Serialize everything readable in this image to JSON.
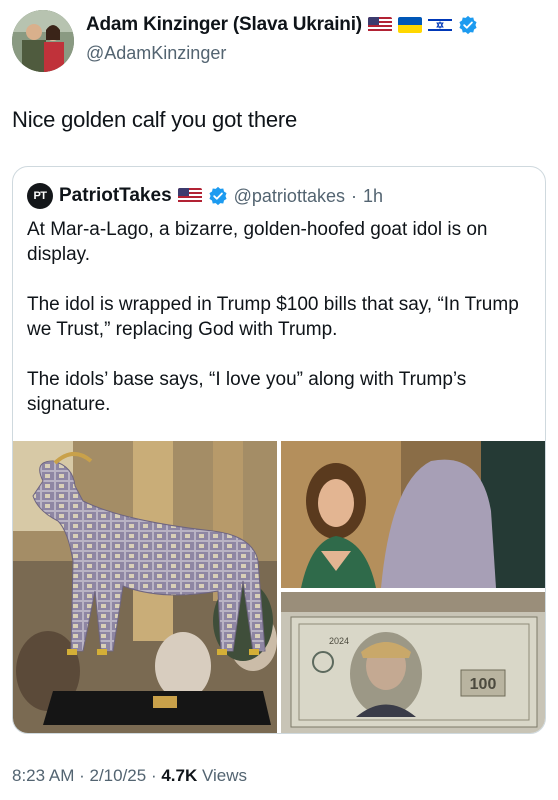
{
  "author": {
    "name": "Adam Kinzinger (Slava Ukraini)",
    "handle": "@AdamKinzinger",
    "flags": [
      "us-flag-icon",
      "ukraine-flag-icon",
      "israel-flag-icon"
    ],
    "verified": true
  },
  "tweet": {
    "text": "Nice golden calf you got there"
  },
  "quote": {
    "logo_text": "PT",
    "name": "PatriotTakes",
    "handle": "@patriottakes",
    "separator": "·",
    "time": "1h",
    "paragraphs": [
      "At Mar-a-Lago, a bizarre, golden-hoofed goat idol is on display.",
      "The idol is wrapped in Trump $100 bills that say, “In Trump we Trust,” replacing God with Trump.",
      "The idols’ base says, “I love you” along with Trump’s signature."
    ],
    "media": [
      {
        "name": "goat-idol-photo"
      },
      {
        "name": "woman-with-idol-photo"
      },
      {
        "name": "trump-100-bill-photo",
        "bill_text": "2024"
      }
    ]
  },
  "meta": {
    "time": "8:23 AM",
    "sep1": " · ",
    "date": "2/10/25",
    "sep2": " · ",
    "views": "4.7K",
    "views_label": " Views"
  },
  "colors": {
    "verified_blue": "#1d9bf0",
    "secondary_text": "#536471",
    "border": "#cfd9de"
  }
}
